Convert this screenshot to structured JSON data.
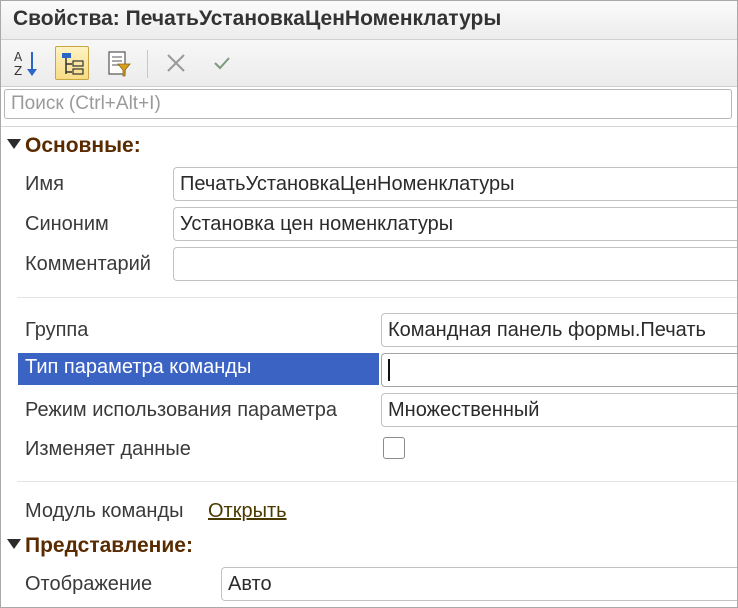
{
  "window": {
    "title": "Свойства: ПечатьУстановкаЦенНоменклатуры"
  },
  "toolbar": {
    "buttons": [
      {
        "icon": "sort-alphabetical-icon",
        "active": false
      },
      {
        "icon": "group-by-category-icon",
        "active": true
      },
      {
        "icon": "filter-properties-icon",
        "active": false
      },
      {
        "icon": "close-icon",
        "active": false
      },
      {
        "icon": "checkmark-icon",
        "active": false
      }
    ]
  },
  "search": {
    "placeholder": "Поиск (Ctrl+Alt+I)"
  },
  "sections": {
    "main": {
      "title": "Основные:",
      "name_label": "Имя",
      "name_value": "ПечатьУстановкаЦенНоменклатуры",
      "synonym_label": "Синоним",
      "synonym_value": "Установка цен номенклатуры",
      "comment_label": "Комментарий",
      "comment_value": "",
      "group_label": "Группа",
      "group_value": "Командная панель формы.Печать",
      "param_type_label": "Тип параметра команды",
      "param_type_value": "",
      "param_mode_label": "Режим использования параметра",
      "param_mode_value": "Множественный",
      "modifies_data_label": "Изменяет данные",
      "modifies_data_checked": false,
      "module_label": "Модуль команды",
      "module_link": "Открыть"
    },
    "presentation": {
      "title": "Представление:",
      "display_label": "Отображение",
      "display_value": "Авто"
    }
  },
  "colors": {
    "selection": "#3b63c4",
    "section_title": "#5a2b00",
    "active_button": "#f7dc86"
  }
}
